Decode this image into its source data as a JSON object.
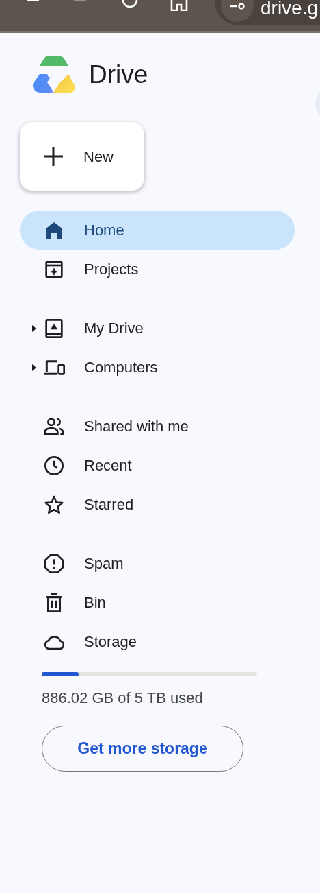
{
  "browser_bar": {
    "back_enabled": true,
    "forward_enabled": false,
    "address": "drive.g"
  },
  "app": {
    "title": "Drive"
  },
  "new_button": {
    "label": "New"
  },
  "nav_groups": [
    [
      {
        "kind": "home",
        "label": "Home",
        "selected": true,
        "expandable": false
      },
      {
        "kind": "projects",
        "label": "Projects",
        "selected": false,
        "expandable": false
      }
    ],
    [
      {
        "kind": "mydrive",
        "label": "My Drive",
        "selected": false,
        "expandable": true
      },
      {
        "kind": "computers",
        "label": "Computers",
        "selected": false,
        "expandable": true
      }
    ],
    [
      {
        "kind": "shared",
        "label": "Shared with me",
        "selected": false,
        "expandable": false
      },
      {
        "kind": "recent",
        "label": "Recent",
        "selected": false,
        "expandable": false
      },
      {
        "kind": "starred",
        "label": "Starred",
        "selected": false,
        "expandable": false
      }
    ],
    [
      {
        "kind": "spam",
        "label": "Spam",
        "selected": false,
        "expandable": false
      },
      {
        "kind": "bin",
        "label": "Bin",
        "selected": false,
        "expandable": false
      },
      {
        "kind": "storage",
        "label": "Storage",
        "selected": false,
        "expandable": false
      }
    ]
  ],
  "storage": {
    "level": 0.17,
    "usage": "886.02 GB of 5 TB used",
    "button": "Get more storage"
  }
}
